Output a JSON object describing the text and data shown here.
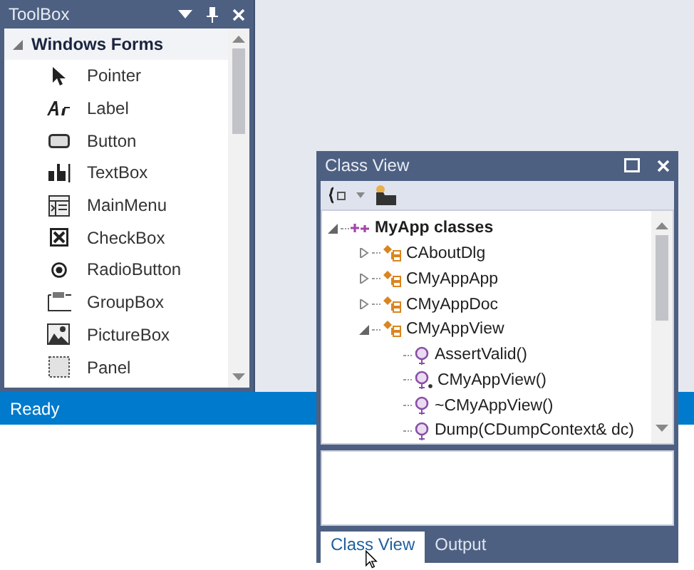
{
  "toolbox": {
    "title": "ToolBox",
    "group": {
      "label": "Windows Forms",
      "expanded": true
    },
    "items": [
      {
        "label": "Pointer"
      },
      {
        "label": "Label"
      },
      {
        "label": "Button"
      },
      {
        "label": "TextBox"
      },
      {
        "label": "MainMenu"
      },
      {
        "label": "CheckBox"
      },
      {
        "label": "RadioButton"
      },
      {
        "label": "GroupBox"
      },
      {
        "label": "PictureBox"
      },
      {
        "label": "Panel"
      }
    ]
  },
  "status_bar": {
    "text": "Ready"
  },
  "class_view": {
    "title": "Class View",
    "tree": [
      {
        "label": "MyApp classes",
        "kind": "root",
        "expanded": true,
        "children": [
          {
            "label": "CAboutDlg",
            "kind": "class",
            "expanded": false
          },
          {
            "label": "CMyAppApp",
            "kind": "class",
            "expanded": false
          },
          {
            "label": "CMyAppDoc",
            "kind": "class",
            "expanded": false
          },
          {
            "label": "CMyAppView",
            "kind": "class",
            "expanded": true,
            "children": [
              {
                "label": "AssertValid()",
                "kind": "method"
              },
              {
                "label": "CMyAppView()",
                "kind": "constructor"
              },
              {
                "label": "~CMyAppView()",
                "kind": "method"
              },
              {
                "label": "Dump(CDumpContext& dc)",
                "kind": "method"
              }
            ]
          }
        ]
      }
    ],
    "tabs": [
      {
        "label": "Class View",
        "selected": true
      },
      {
        "label": "Output",
        "selected": false
      }
    ]
  }
}
